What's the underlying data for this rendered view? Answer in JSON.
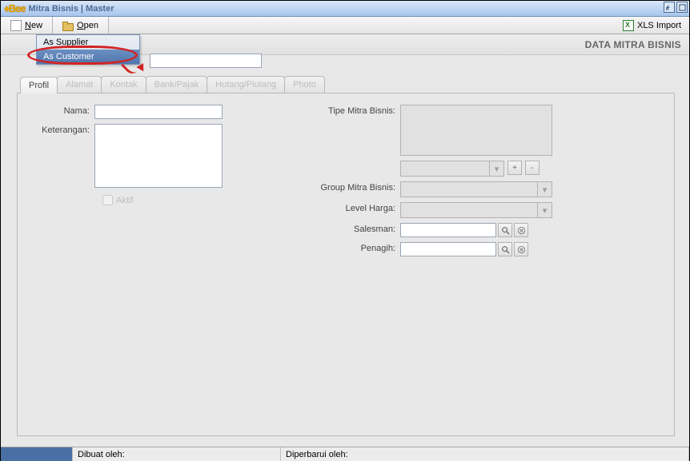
{
  "titlebar": {
    "logo_text": "Bee",
    "title": "Mitra Bisnis | Master"
  },
  "toolbar": {
    "new_prefix": "N",
    "new_rest": "ew",
    "open_prefix": "O",
    "open_rest": "pen",
    "xls_import_prefix": "X",
    "xls_import_rest": "LS Import"
  },
  "dropdown": {
    "items": [
      "As Supplier",
      "As Customer"
    ],
    "selected": "As Customer"
  },
  "header": {
    "title": "DATA MITRA BISNIS"
  },
  "code_row": {
    "label": "",
    "value": ""
  },
  "tabs": [
    "Profil",
    "Alamat",
    "Kontak",
    "Bank/Pajak",
    "Hutang/Piutang",
    "Photo"
  ],
  "active_tab": "Profil",
  "profil": {
    "nama_label": "Nama:",
    "nama_value": "",
    "ket_label": "Keterangan:",
    "ket_value": "",
    "aktif_label": "Aktif",
    "tipe_label": "Tipe Mitra Bisnis:"
  },
  "right_form": {
    "group_label": "Group Mitra Bisnis:",
    "level_label": "Level Harga:",
    "salesman_label": "Salesman:",
    "salesman_value": "",
    "penagih_label": "Penagih:",
    "penagih_value": "",
    "plus": "+",
    "minus": "-"
  },
  "statusbar": {
    "created_by_label": "Dibuat oleh:",
    "updated_by_label": "Diperbarui oleh:"
  }
}
